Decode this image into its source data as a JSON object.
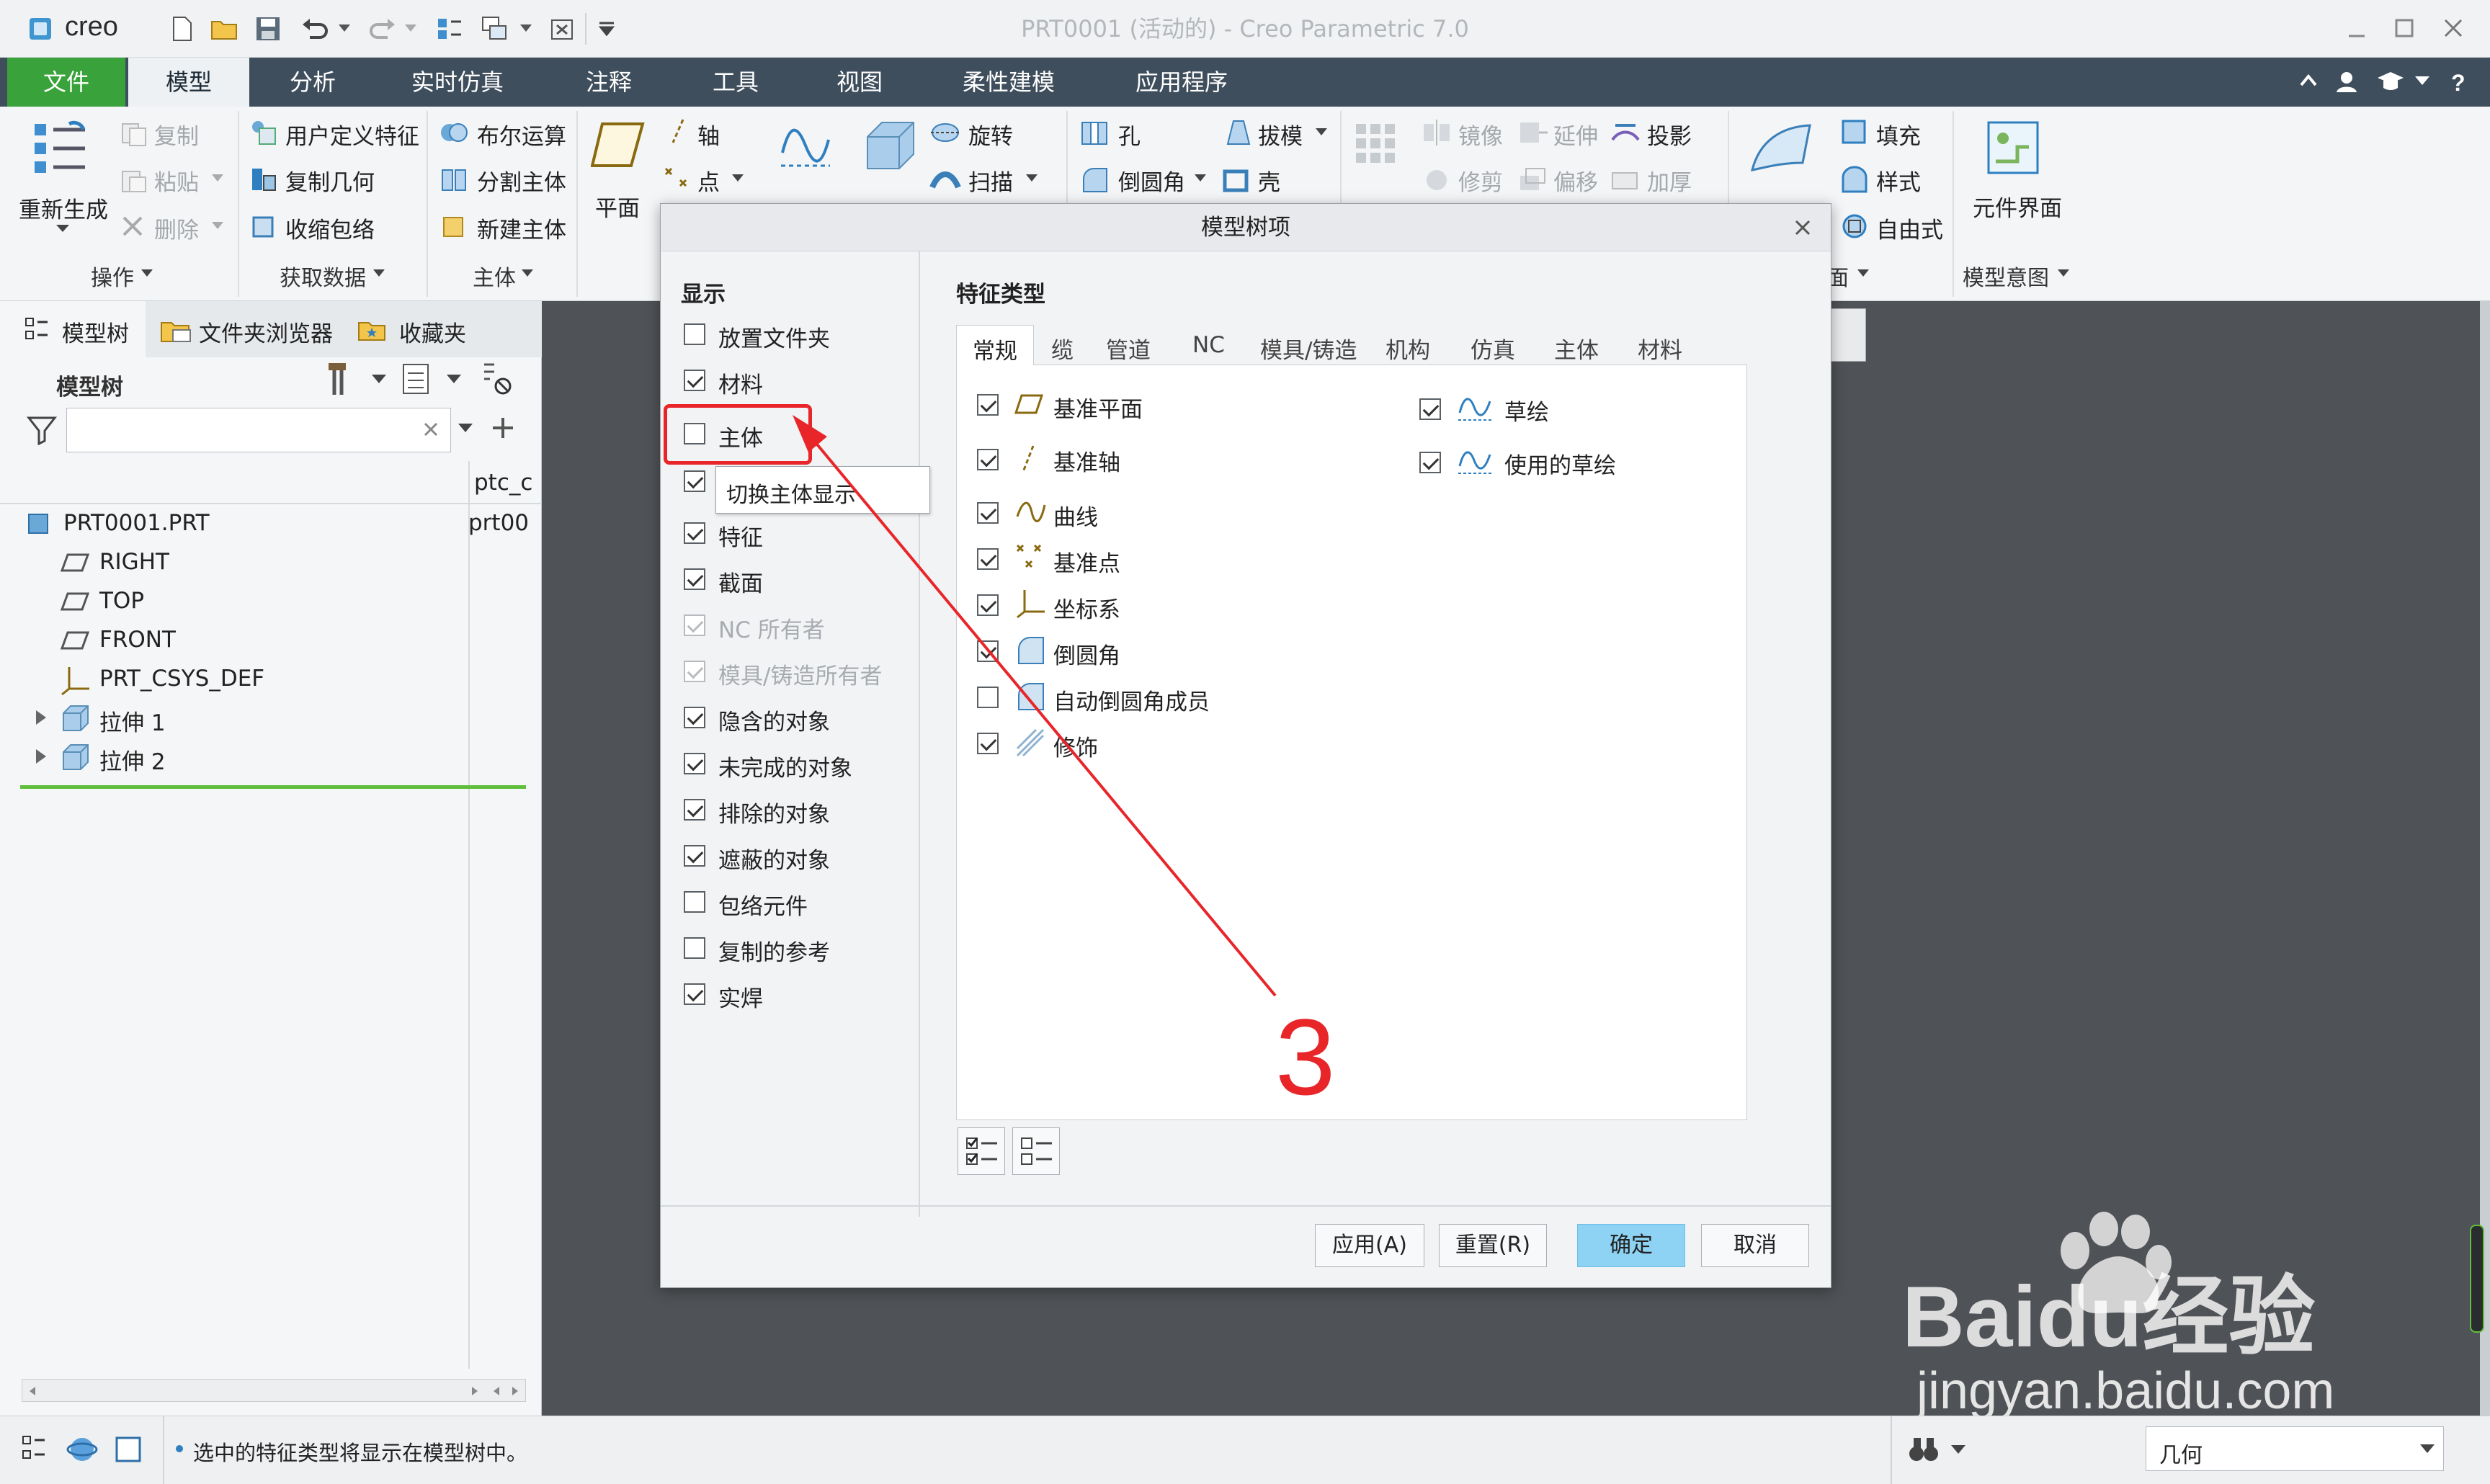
{
  "window": {
    "logo": "creo",
    "title": "PRT0001 (活动的) - Creo Parametric 7.0"
  },
  "menu_tabs": [
    "文件",
    "模型",
    "分析",
    "实时仿真",
    "注释",
    "工具",
    "视图",
    "柔性建模",
    "应用程序"
  ],
  "ribbon": {
    "regenerate": "重新生成",
    "copy": "复制",
    "paste": "粘贴",
    "delete": "删除",
    "udf": "用户定义特征",
    "copy_geom": "复制几何",
    "shrinkwrap": "收缩包络",
    "boolean": "布尔运算",
    "split_body": "分割主体",
    "new_body": "新建主体",
    "plane": "平面",
    "axis": "轴",
    "point": "点",
    "revolve": "旋转",
    "sweep": "扫描",
    "hole": "孔",
    "round": "倒圆角",
    "draft": "拔模",
    "shell": "壳",
    "mirror": "镜像",
    "trim": "修剪",
    "extend": "延伸",
    "offset": "偏移",
    "project": "投影",
    "thicken": "加厚",
    "fill": "填充",
    "style": "样式",
    "freestyle": "自由式",
    "component_interface": "元件界面",
    "groups": {
      "operations": "操作",
      "get_data": "获取数据",
      "body": "主体",
      "surfaces_partial": "面",
      "model_intent": "模型意图"
    }
  },
  "left_panel": {
    "tabs": [
      "模型树",
      "文件夹浏览器",
      "收藏夹"
    ],
    "header": "模型树",
    "search_placeholder": "",
    "col_header": "ptc_c",
    "col_value": "prt00",
    "items": [
      {
        "label": "PRT0001.PRT",
        "icon": "part-icon",
        "expandable": false
      },
      {
        "label": "RIGHT",
        "icon": "datum-plane-icon",
        "expandable": false
      },
      {
        "label": "TOP",
        "icon": "datum-plane-icon",
        "expandable": false
      },
      {
        "label": "FRONT",
        "icon": "datum-plane-icon",
        "expandable": false
      },
      {
        "label": "PRT_CSYS_DEF",
        "icon": "csys-icon",
        "expandable": false
      },
      {
        "label": "拉伸 1",
        "icon": "extrude-icon",
        "expandable": true
      },
      {
        "label": "拉伸 2",
        "icon": "extrude-icon",
        "expandable": true
      }
    ]
  },
  "dialog": {
    "title": "模型树项",
    "display_heading": "显示",
    "display_options": [
      {
        "label": "放置文件夹",
        "checked": false,
        "disabled": false
      },
      {
        "label": "材料",
        "checked": true,
        "disabled": false
      },
      {
        "label": "主体",
        "checked": false,
        "disabled": false
      },
      {
        "label": "",
        "checked": true,
        "disabled": false
      },
      {
        "label": "特征",
        "checked": true,
        "disabled": false
      },
      {
        "label": "截面",
        "checked": true,
        "disabled": false
      },
      {
        "label": "NC 所有者",
        "checked": true,
        "disabled": true
      },
      {
        "label": "模具/铸造所有者",
        "checked": true,
        "disabled": true
      },
      {
        "label": "隐含的对象",
        "checked": true,
        "disabled": false
      },
      {
        "label": "未完成的对象",
        "checked": true,
        "disabled": false
      },
      {
        "label": "排除的对象",
        "checked": true,
        "disabled": false
      },
      {
        "label": "遮蔽的对象",
        "checked": true,
        "disabled": false
      },
      {
        "label": "包络元件",
        "checked": false,
        "disabled": false
      },
      {
        "label": "复制的参考",
        "checked": false,
        "disabled": false
      },
      {
        "label": "实焊",
        "checked": true,
        "disabled": false
      }
    ],
    "tooltip": "切换主体显示",
    "feature_heading": "特征类型",
    "feature_tabs": [
      "常规",
      "缆",
      "管道",
      "NC",
      "模具/铸造",
      "机构",
      "仿真",
      "主体",
      "材料"
    ],
    "features_left": [
      {
        "label": "基准平面",
        "checked": true,
        "icon": "datum-plane-icon"
      },
      {
        "label": "基准轴",
        "checked": true,
        "icon": "datum-axis-icon"
      },
      {
        "label": "曲线",
        "checked": true,
        "icon": "curve-icon"
      },
      {
        "label": "基准点",
        "checked": true,
        "icon": "datum-point-icon"
      },
      {
        "label": "坐标系",
        "checked": true,
        "icon": "csys-icon"
      },
      {
        "label": "倒圆角",
        "checked": true,
        "icon": "round-icon"
      },
      {
        "label": "自动倒圆角成员",
        "checked": false,
        "icon": "auto-round-icon"
      },
      {
        "label": "修饰",
        "checked": true,
        "icon": "cosmetic-icon"
      }
    ],
    "features_right": [
      {
        "label": "草绘",
        "checked": true,
        "icon": "sketch-icon"
      },
      {
        "label": "使用的草绘",
        "checked": true,
        "icon": "used-sketch-icon"
      }
    ],
    "buttons": {
      "apply": "应用(A)",
      "reset": "重置(R)",
      "ok": "确定",
      "cancel": "取消"
    }
  },
  "annotation": {
    "number": "3",
    "color": "#e8262a"
  },
  "statusbar": {
    "message": "选中的特征类型将显示在模型树中。",
    "filter": "几何"
  },
  "watermark": {
    "brand": "Baidu经验",
    "url": "jingyan.baidu.com"
  },
  "colors": {
    "file_tab": "#3aa23a",
    "tabs_bg": "#3f4e5c",
    "primary_button": "#8ed3f3",
    "canvas": "#4f5256"
  }
}
